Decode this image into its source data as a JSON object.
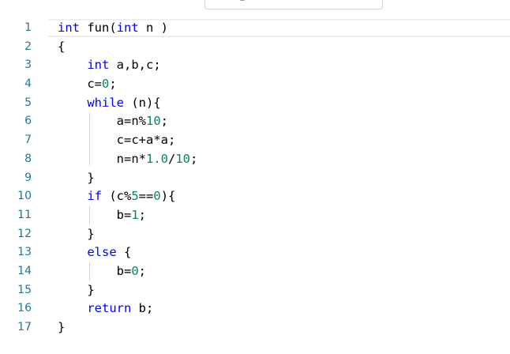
{
  "editor": {
    "line_numbers": [
      "1",
      "2",
      "3",
      "4",
      "5",
      "6",
      "7",
      "8",
      "9",
      "10",
      "11",
      "12",
      "13",
      "14",
      "15",
      "16",
      "17"
    ],
    "lines": [
      [
        {
          "t": "int",
          "c": "kw"
        },
        {
          "t": " fun("
        },
        {
          "t": "int",
          "c": "kw"
        },
        {
          "t": " n )"
        }
      ],
      [
        {
          "t": "{"
        }
      ],
      [
        {
          "t": "    "
        },
        {
          "t": "int",
          "c": "kw"
        },
        {
          "t": " a,b,c;"
        }
      ],
      [
        {
          "t": "    c="
        },
        {
          "t": "0",
          "c": "num"
        },
        {
          "t": ";"
        }
      ],
      [
        {
          "t": "    "
        },
        {
          "t": "while",
          "c": "kw"
        },
        {
          "t": " (n){"
        }
      ],
      [
        {
          "t": "        a=n%"
        },
        {
          "t": "10",
          "c": "num"
        },
        {
          "t": ";"
        }
      ],
      [
        {
          "t": "        c=c+a*a;"
        }
      ],
      [
        {
          "t": "        n=n*"
        },
        {
          "t": "1.0",
          "c": "num"
        },
        {
          "t": "/"
        },
        {
          "t": "10",
          "c": "num"
        },
        {
          "t": ";"
        }
      ],
      [
        {
          "t": "    }"
        }
      ],
      [
        {
          "t": "    "
        },
        {
          "t": "if",
          "c": "kw"
        },
        {
          "t": " (c%"
        },
        {
          "t": "5",
          "c": "num"
        },
        {
          "t": "=="
        },
        {
          "t": "0",
          "c": "num"
        },
        {
          "t": "){"
        }
      ],
      [
        {
          "t": "        b="
        },
        {
          "t": "1",
          "c": "num"
        },
        {
          "t": ";"
        }
      ],
      [
        {
          "t": "    }"
        }
      ],
      [
        {
          "t": "    "
        },
        {
          "t": "else",
          "c": "kw"
        },
        {
          "t": " {"
        }
      ],
      [
        {
          "t": "        b="
        },
        {
          "t": "0",
          "c": "num"
        },
        {
          "t": ";"
        }
      ],
      [
        {
          "t": "    }"
        }
      ],
      [
        {
          "t": "    "
        },
        {
          "t": "return",
          "c": "kw"
        },
        {
          "t": " b;"
        }
      ],
      [
        {
          "t": "}"
        }
      ]
    ]
  },
  "colors": {
    "keyword": "#0000ff",
    "number": "#098658",
    "line_number": "#237893",
    "text": "#000000"
  }
}
